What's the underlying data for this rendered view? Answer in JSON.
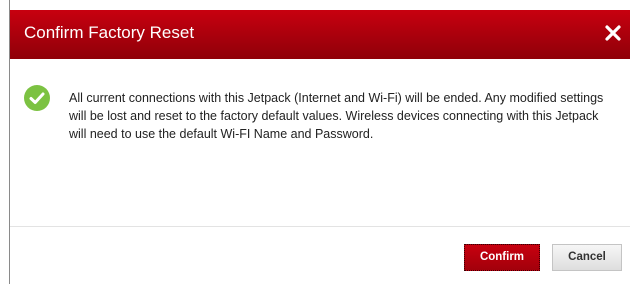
{
  "dialog": {
    "title": "Confirm Factory Reset",
    "close_icon": "close-icon",
    "status_icon": "check-circle-icon",
    "message": "All current connections with this Jetpack (Internet and Wi-Fi) will be ended. Any modified settings will be lost and reset to the factory default values. Wireless devices connecting with this Jetpack will need to use the default Wi-FI Name and Password.",
    "confirm_label": "Confirm",
    "cancel_label": "Cancel"
  },
  "colors": {
    "header_red": "#b0000c",
    "confirm_red": "#b5000d",
    "check_green": "#7cc242"
  }
}
